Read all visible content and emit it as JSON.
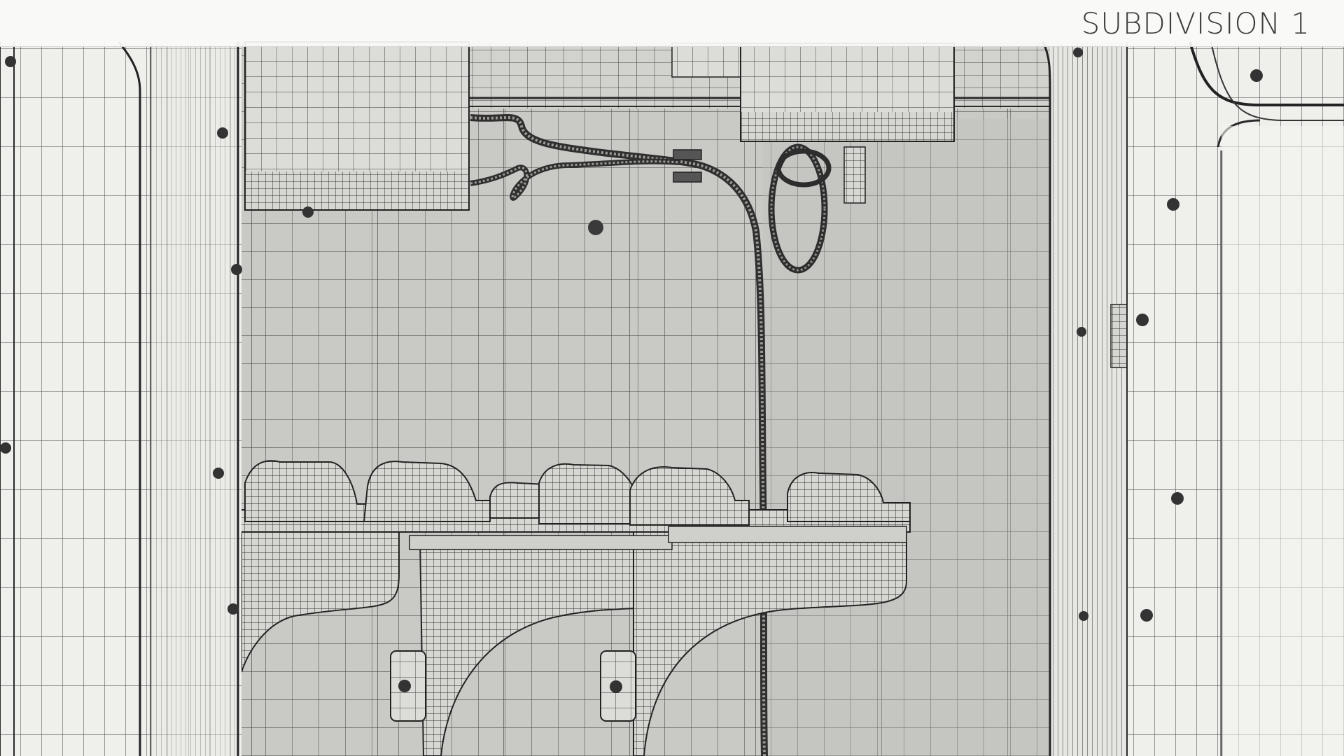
{
  "header": {
    "title": "SUBDIVISION 1"
  },
  "viewport": {
    "subject": "wireframe-render",
    "colors": {
      "background": "#e9e9e6",
      "wall": "#c9cac6",
      "wall_shade": "#b9bab6",
      "pillar": "#f1f1ee",
      "wire": "#2e2e2e",
      "wire_light": "#6d6d6a"
    }
  }
}
